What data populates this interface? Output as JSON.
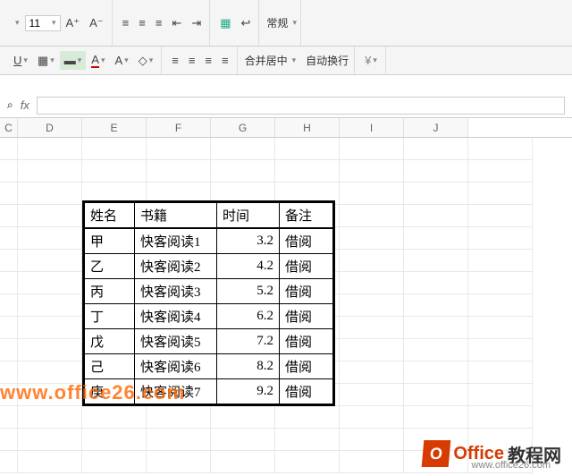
{
  "ribbon": {
    "font_size": "11",
    "merge_center": "合并居中",
    "wrap_text": "自动换行",
    "number_format": "常规"
  },
  "formula_bar": {
    "search_icon": "⌕",
    "fx": "fx"
  },
  "columns": [
    "C",
    "D",
    "E",
    "F",
    "G",
    "H",
    "I",
    "J"
  ],
  "table": {
    "headers": {
      "name": "姓名",
      "book": "书籍",
      "time": "时间",
      "note": "备注"
    },
    "rows": [
      {
        "name": "甲",
        "book": "快客阅读1",
        "time": "3.2",
        "note": "借阅"
      },
      {
        "name": "乙",
        "book": "快客阅读2",
        "time": "4.2",
        "note": "借阅"
      },
      {
        "name": "丙",
        "book": "快客阅读3",
        "time": "5.2",
        "note": "借阅"
      },
      {
        "name": "丁",
        "book": "快客阅读4",
        "time": "6.2",
        "note": "借阅"
      },
      {
        "name": "戊",
        "book": "快客阅读5",
        "time": "7.2",
        "note": "借阅"
      },
      {
        "name": "己",
        "book": "快客阅读6",
        "time": "8.2",
        "note": "借阅"
      },
      {
        "name": "庚",
        "book": "快客阅读7",
        "time": "9.2",
        "note": "借阅"
      }
    ]
  },
  "watermark": "www.office26.com",
  "logo": {
    "badge": "O",
    "t1": "Office",
    "t2": "教程网",
    "sub": "www.office26.com"
  }
}
